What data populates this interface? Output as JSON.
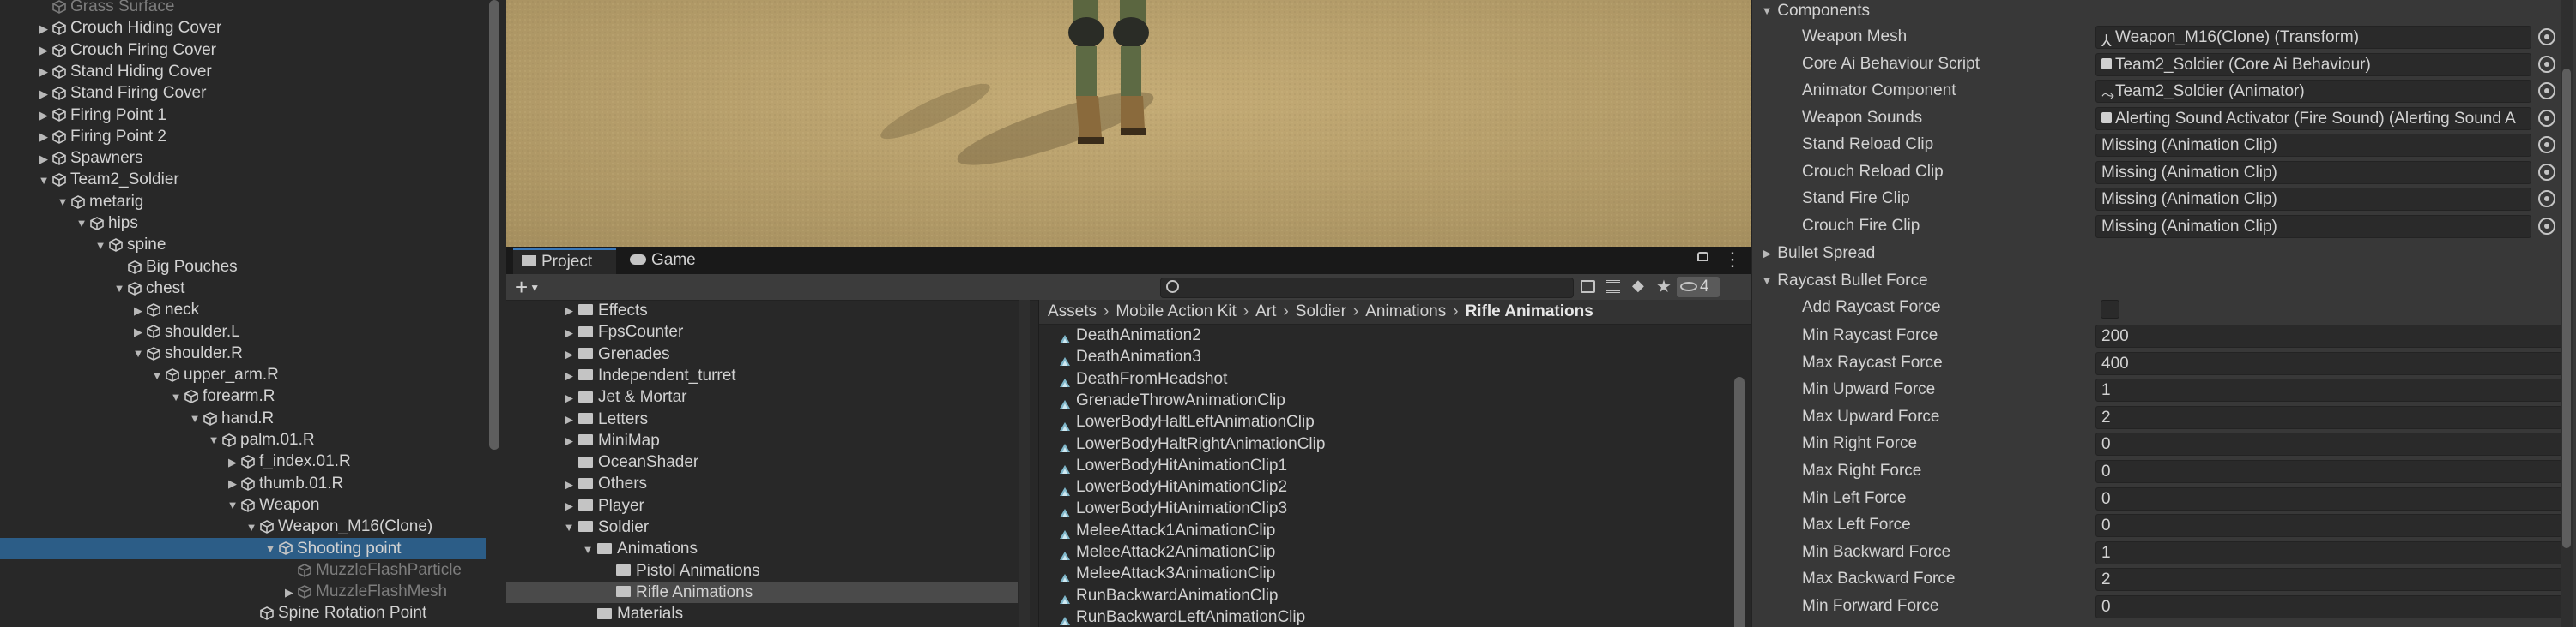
{
  "hierarchy": {
    "items": [
      {
        "label": "Grass Surface",
        "indent": 0,
        "arrow": "",
        "dim": true
      },
      {
        "label": "Crouch Hiding Cover",
        "indent": 0,
        "arrow": "right"
      },
      {
        "label": "Crouch Firing Cover",
        "indent": 0,
        "arrow": "right"
      },
      {
        "label": "Stand Hiding Cover",
        "indent": 0,
        "arrow": "right"
      },
      {
        "label": "Stand Firing Cover",
        "indent": 0,
        "arrow": "right"
      },
      {
        "label": "Firing Point 1",
        "indent": 0,
        "arrow": "right"
      },
      {
        "label": "Firing Point 2",
        "indent": 0,
        "arrow": "right"
      },
      {
        "label": "Spawners",
        "indent": 0,
        "arrow": "right"
      },
      {
        "label": "Team2_Soldier",
        "indent": 0,
        "arrow": "down"
      },
      {
        "label": "metarig",
        "indent": 1,
        "arrow": "down"
      },
      {
        "label": "hips",
        "indent": 2,
        "arrow": "down"
      },
      {
        "label": "spine",
        "indent": 3,
        "arrow": "down"
      },
      {
        "label": "Big Pouches",
        "indent": 4,
        "arrow": ""
      },
      {
        "label": "chest",
        "indent": 4,
        "arrow": "down"
      },
      {
        "label": "neck",
        "indent": 5,
        "arrow": "right"
      },
      {
        "label": "shoulder.L",
        "indent": 5,
        "arrow": "right"
      },
      {
        "label": "shoulder.R",
        "indent": 5,
        "arrow": "down"
      },
      {
        "label": "upper_arm.R",
        "indent": 6,
        "arrow": "down"
      },
      {
        "label": "forearm.R",
        "indent": 7,
        "arrow": "down"
      },
      {
        "label": "hand.R",
        "indent": 8,
        "arrow": "down"
      },
      {
        "label": "palm.01.R",
        "indent": 9,
        "arrow": "down"
      },
      {
        "label": "f_index.01.R",
        "indent": 10,
        "arrow": "right"
      },
      {
        "label": "thumb.01.R",
        "indent": 10,
        "arrow": "right"
      },
      {
        "label": "Weapon",
        "indent": 10,
        "arrow": "down"
      },
      {
        "label": "Weapon_M16(Clone)",
        "indent": 11,
        "arrow": "down"
      },
      {
        "label": "Shooting point",
        "indent": 12,
        "arrow": "down",
        "selected": true
      },
      {
        "label": "MuzzleFlashParticle",
        "indent": 13,
        "arrow": "",
        "dim": true
      },
      {
        "label": "MuzzleFlashMesh",
        "indent": 13,
        "arrow": "right",
        "dim": true
      },
      {
        "label": "Spine Rotation Point",
        "indent": 11,
        "arrow": ""
      }
    ]
  },
  "project": {
    "tabs": [
      {
        "label": "Project",
        "active": true,
        "icon": "folder-icon"
      },
      {
        "label": "Game",
        "active": false,
        "icon": "gamepad-icon"
      }
    ],
    "add_label": "+",
    "search_placeholder": "",
    "hidden_count": "4",
    "folders": [
      {
        "label": "Effects",
        "indent": 0,
        "arrow": "right"
      },
      {
        "label": "FpsCounter",
        "indent": 0,
        "arrow": "right"
      },
      {
        "label": "Grenades",
        "indent": 0,
        "arrow": "right"
      },
      {
        "label": "Independent_turret",
        "indent": 0,
        "arrow": "right"
      },
      {
        "label": "Jet & Mortar",
        "indent": 0,
        "arrow": "right"
      },
      {
        "label": "Letters",
        "indent": 0,
        "arrow": "right"
      },
      {
        "label": "MiniMap",
        "indent": 0,
        "arrow": "right"
      },
      {
        "label": "OceanShader",
        "indent": 0,
        "arrow": ""
      },
      {
        "label": "Others",
        "indent": 0,
        "arrow": "right"
      },
      {
        "label": "Player",
        "indent": 0,
        "arrow": "right"
      },
      {
        "label": "Soldier",
        "indent": 0,
        "arrow": "down"
      },
      {
        "label": "Animations",
        "indent": 1,
        "arrow": "down"
      },
      {
        "label": "Pistol Animations",
        "indent": 2,
        "arrow": ""
      },
      {
        "label": "Rifle Animations",
        "indent": 2,
        "arrow": "",
        "selected": true
      },
      {
        "label": "Materials",
        "indent": 1,
        "arrow": ""
      }
    ],
    "breadcrumb": [
      "Assets",
      "Mobile Action Kit",
      "Art",
      "Soldier",
      "Animations",
      "Rifle Animations"
    ],
    "files": [
      "DeathAnimation2",
      "DeathAnimation3",
      "DeathFromHeadshot",
      "GrenadeThrowAnimationClip",
      "LowerBodyHaltLeftAnimationClip",
      "LowerBodyHaltRightAnimationClip",
      "LowerBodyHitAnimationClip1",
      "LowerBodyHitAnimationClip2",
      "LowerBodyHitAnimationClip3",
      "MeleeAttack1AnimationClip",
      "MeleeAttack2AnimationClip",
      "MeleeAttack3AnimationClip",
      "RunBackwardAnimationClip",
      "RunBackwardLeftAnimationClip"
    ]
  },
  "inspector": {
    "components_label": "Components",
    "components": [
      {
        "label": "Weapon Mesh",
        "value": "Weapon_M16(Clone) (Transform)",
        "icon": "transform-icon"
      },
      {
        "label": "Core Ai Behaviour Script",
        "value": "Team2_Soldier (Core Ai Behaviour)",
        "icon": "script-icon"
      },
      {
        "label": "Animator Component",
        "value": "Team2_Soldier (Animator)",
        "icon": "animator-icon"
      },
      {
        "label": "Weapon Sounds",
        "value": "Alerting Sound Activator (Fire Sound) (Alerting Sound A",
        "icon": "script-icon"
      },
      {
        "label": "Stand Reload Clip",
        "value": "Missing (Animation Clip)",
        "icon": ""
      },
      {
        "label": "Crouch Reload Clip",
        "value": "Missing (Animation Clip)",
        "icon": ""
      },
      {
        "label": "Stand Fire Clip",
        "value": "Missing (Animation Clip)",
        "icon": ""
      },
      {
        "label": "Crouch Fire Clip",
        "value": "Missing (Animation Clip)",
        "icon": ""
      }
    ],
    "bullet_spread_label": "Bullet Spread",
    "raycast_label": "Raycast Bullet Force",
    "add_raycast_label": "Add Raycast Force",
    "add_raycast_checked": false,
    "numbers": [
      {
        "label": "Min Raycast Force",
        "value": "200"
      },
      {
        "label": "Max Raycast Force",
        "value": "400"
      },
      {
        "label": "Min Upward Force",
        "value": "1"
      },
      {
        "label": "Max Upward Force",
        "value": "2"
      },
      {
        "label": "Min Right Force",
        "value": "0"
      },
      {
        "label": "Max Right Force",
        "value": "0"
      },
      {
        "label": "Min Left Force",
        "value": "0"
      },
      {
        "label": "Max Left Force",
        "value": "0"
      },
      {
        "label": "Min Backward Force",
        "value": "1"
      },
      {
        "label": "Max Backward Force",
        "value": "2"
      },
      {
        "label": "Min Forward Force",
        "value": "0"
      }
    ]
  },
  "colors": {
    "selection": "#2c5d87",
    "accent": "#3a79bb",
    "panel": "#282828",
    "inspector": "#383838"
  }
}
